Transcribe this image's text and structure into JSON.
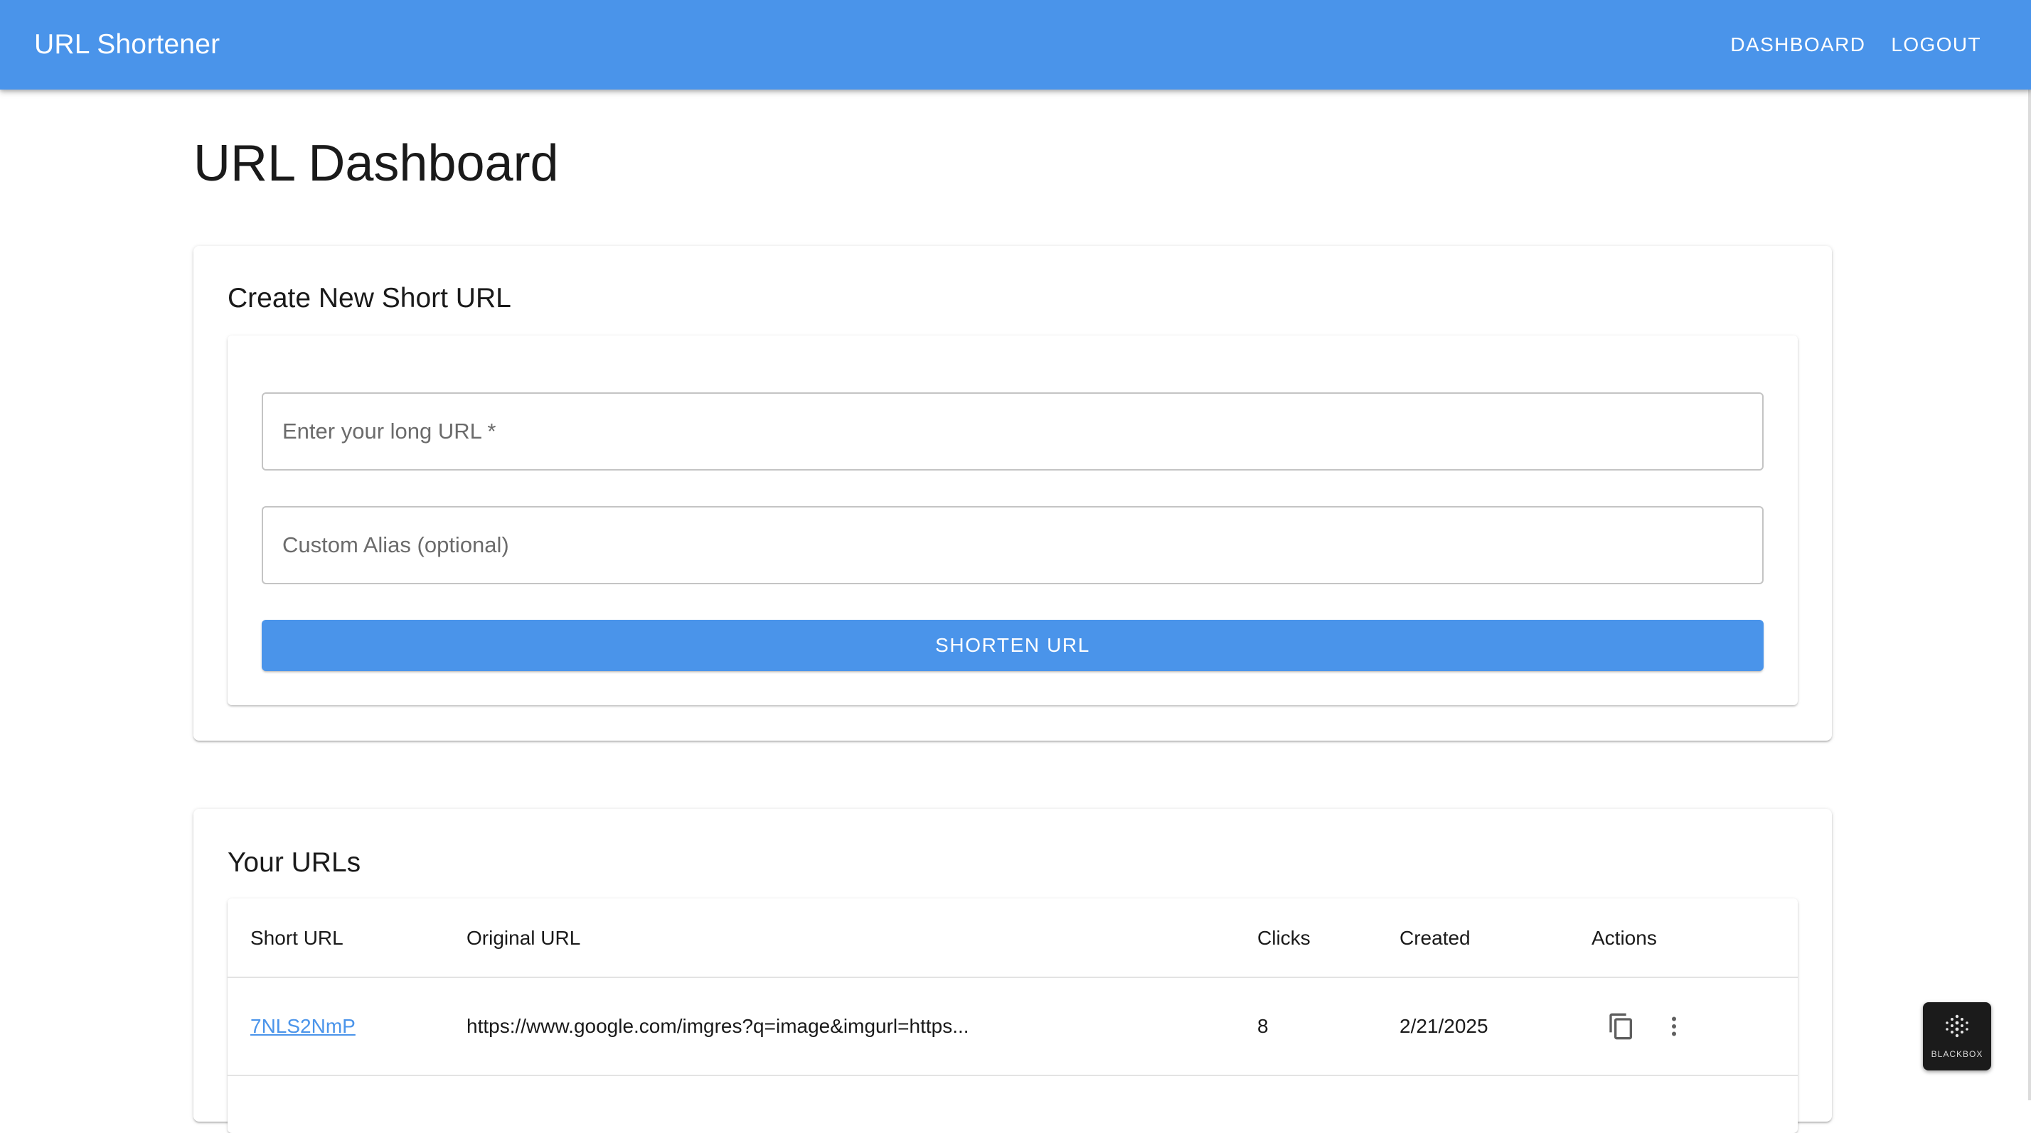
{
  "app": {
    "title": "URL Shortener",
    "accent_color": "#4a94ea"
  },
  "nav": {
    "dashboard_label": "DASHBOARD",
    "logout_label": "LOGOUT"
  },
  "page": {
    "title": "URL Dashboard"
  },
  "create_card": {
    "heading": "Create New Short URL",
    "long_url_field": {
      "label": "Enter your long URL *",
      "value": ""
    },
    "alias_field": {
      "label": "Custom Alias (optional)",
      "value": ""
    },
    "submit_label": "SHORTEN URL"
  },
  "urls_card": {
    "heading": "Your URLs",
    "columns": {
      "short_url": "Short URL",
      "original_url": "Original URL",
      "clicks": "Clicks",
      "created": "Created",
      "actions": "Actions"
    },
    "rows": [
      {
        "short_url": "7NLS2NmP",
        "original_url": "https://www.google.com/imgres?q=image&imgurl=https...",
        "clicks": "8",
        "created": "2/21/2025",
        "actions": [
          "copy-icon",
          "more-vert-icon"
        ]
      }
    ]
  },
  "widget": {
    "label": "BLACKBOX",
    "icon": "dot-grid-logo"
  }
}
